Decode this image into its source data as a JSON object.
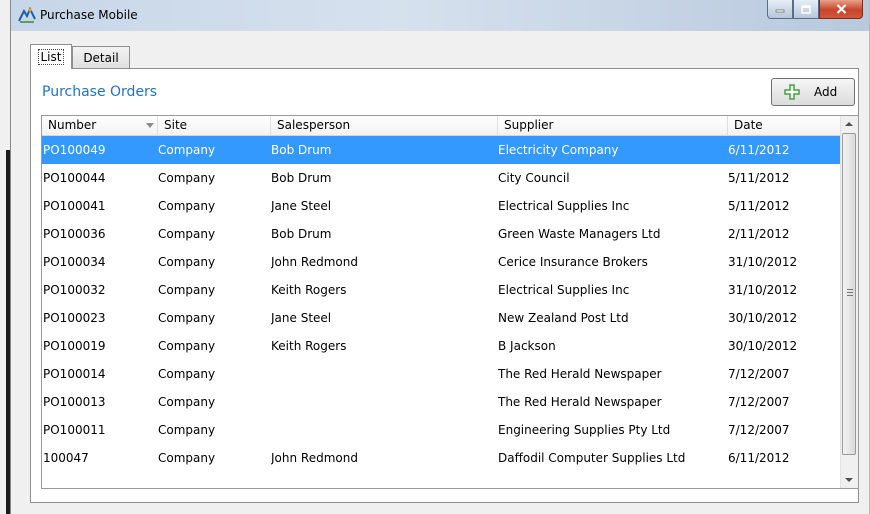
{
  "window": {
    "title": "Purchase Mobile"
  },
  "tabs": [
    {
      "label": "List"
    },
    {
      "label": "Detail"
    }
  ],
  "section": {
    "title": "Purchase Orders"
  },
  "toolbar": {
    "add_label": "Add"
  },
  "table": {
    "columns": [
      "Number",
      "Site",
      "Salesperson",
      "Supplier",
      "Date"
    ],
    "sorted_column": "Number",
    "selected_row": 0,
    "rows": [
      [
        "PO100049",
        "Company",
        "Bob Drum",
        "Electricity Company",
        "6/11/2012"
      ],
      [
        "PO100044",
        "Company",
        "Bob Drum",
        "City Council",
        "5/11/2012"
      ],
      [
        "PO100041",
        "Company",
        "Jane Steel",
        "Electrical Supplies Inc",
        "5/11/2012"
      ],
      [
        "PO100036",
        "Company",
        "Bob Drum",
        "Green Waste Managers Ltd",
        "2/11/2012"
      ],
      [
        "PO100034",
        "Company",
        "John Redmond",
        "Cerice Insurance Brokers",
        "31/10/2012"
      ],
      [
        "PO100032",
        "Company",
        "Keith Rogers",
        "Electrical Supplies Inc",
        "31/10/2012"
      ],
      [
        "PO100023",
        "Company",
        "Jane Steel",
        "New Zealand Post Ltd",
        "30/10/2012"
      ],
      [
        "PO100019",
        "Company",
        "Keith Rogers",
        "B Jackson",
        "30/10/2012"
      ],
      [
        "PO100014",
        "Company",
        "",
        "The Red Herald Newspaper",
        "7/12/2007"
      ],
      [
        "PO100013",
        "Company",
        "",
        "The Red Herald Newspaper",
        "7/12/2007"
      ],
      [
        "PO100011",
        "Company",
        "",
        "Engineering Supplies Pty Ltd",
        "7/12/2007"
      ],
      [
        "100047",
        "Company",
        "John Redmond",
        "Daffodil Computer Supplies Ltd",
        "6/11/2012"
      ]
    ]
  },
  "colors": {
    "selection": "#3399ff",
    "title_accent": "#1e73c8",
    "add_icon": "#3ea33e"
  },
  "icons": {
    "app": "purchase-mobile-app-icon",
    "add": "plus-icon",
    "sort": "sort-descending-icon"
  }
}
